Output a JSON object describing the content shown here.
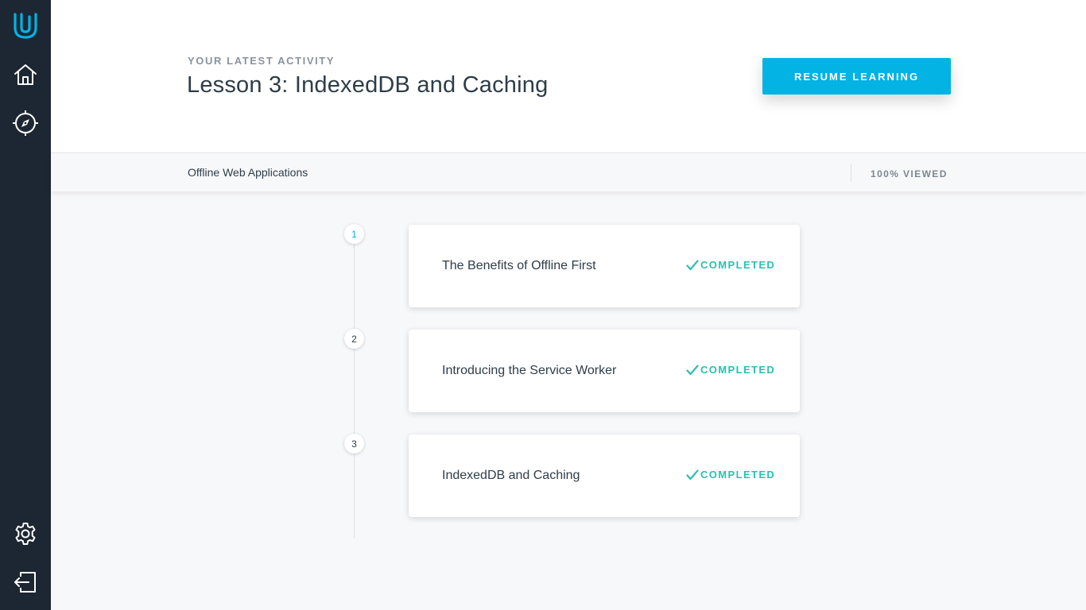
{
  "sidebar": {
    "items": [
      {
        "icon": "udacity-logo-icon"
      },
      {
        "icon": "home-icon"
      },
      {
        "icon": "compass-icon"
      },
      {
        "icon": "gear-icon"
      },
      {
        "icon": "logout-icon"
      }
    ]
  },
  "header": {
    "eyebrow": "YOUR LATEST ACTIVITY",
    "title": "Lesson 3: IndexedDB and Caching",
    "resume_label": "RESUME LEARNING"
  },
  "subbar": {
    "course_name": "Offline Web Applications",
    "viewed": "100% VIEWED"
  },
  "concepts": [
    {
      "number": "1",
      "title": "The Benefits of Offline First",
      "status": "COMPLETED"
    },
    {
      "number": "2",
      "title": "Introducing the Service Worker",
      "status": "COMPLETED"
    },
    {
      "number": "3",
      "title": "IndexedDB and Caching",
      "status": "COMPLETED"
    }
  ],
  "colors": {
    "sidebar": "#1d2733",
    "accent": "#02b3e4",
    "completed": "#2bbfb0",
    "text": "#2e3d49"
  }
}
